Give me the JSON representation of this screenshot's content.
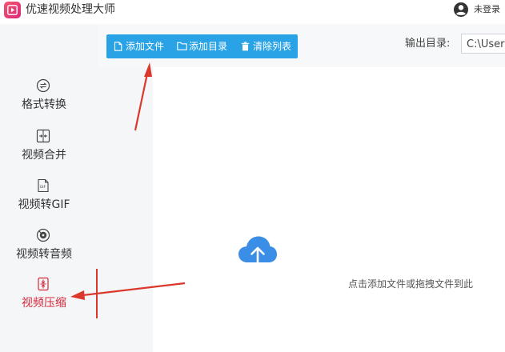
{
  "app": {
    "title": "优速视频处理大师",
    "login_label": "未登录"
  },
  "sidebar": {
    "items": [
      {
        "label": "格式转换",
        "icon": "format-convert-icon",
        "active": false
      },
      {
        "label": "视频合并",
        "icon": "merge-icon",
        "active": false
      },
      {
        "label": "视频转GIF",
        "icon": "gif-icon",
        "active": false
      },
      {
        "label": "视频转音频",
        "icon": "audio-icon",
        "active": false
      },
      {
        "label": "视频压缩",
        "icon": "compress-icon",
        "active": true
      }
    ]
  },
  "toolbar": {
    "add_file": "添加文件",
    "add_folder": "添加目录",
    "clear_list": "清除列表",
    "output_label": "输出目录:",
    "output_path": "C:\\Users"
  },
  "drop_zone": {
    "hint": "点击添加文件或拖拽文件到此"
  },
  "colors": {
    "accent": "#2aa3e6",
    "active_nav": "#d4283a",
    "annotation": "#d9382b"
  }
}
